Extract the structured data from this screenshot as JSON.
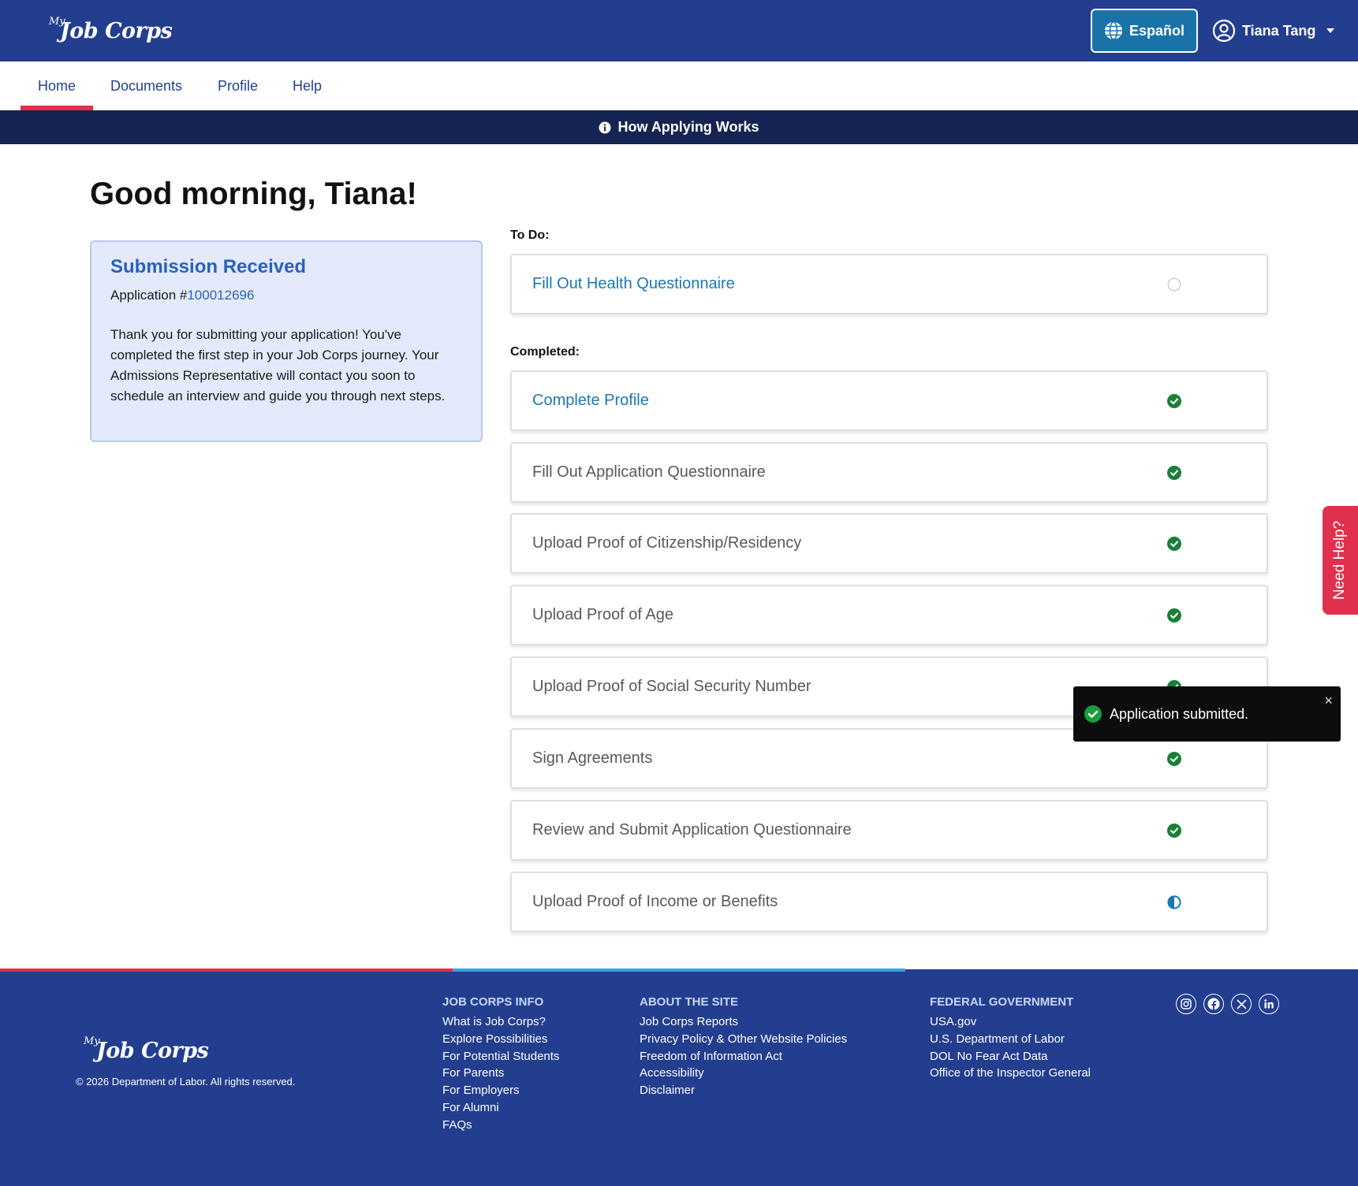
{
  "header": {
    "logo_my": "My",
    "logo_text": "Job Corps",
    "language_button": "Español",
    "user_name": "Tiana Tang"
  },
  "nav": {
    "tabs": [
      {
        "label": "Home",
        "active": true
      },
      {
        "label": "Documents",
        "active": false
      },
      {
        "label": "Profile",
        "active": false
      },
      {
        "label": "Help",
        "active": false
      }
    ]
  },
  "info_bar": {
    "label": "How Applying Works"
  },
  "main": {
    "greeting": "Good morning, Tiana!",
    "submission_card": {
      "title": "Submission Received",
      "application_prefix": "Application #",
      "application_number": "100012696",
      "body": "Thank you for submitting your application! You've completed the first step in your Job Corps journey. Your Admissions Representative will contact you soon to schedule an interview and guide you through next steps."
    },
    "todo_label": "To Do:",
    "todo_items": [
      {
        "label": "Fill Out Health Questionnaire",
        "status": "not-started"
      }
    ],
    "completed_label": "Completed:",
    "completed_items": [
      {
        "label": "Complete Profile",
        "status": "complete"
      },
      {
        "label": "Fill Out Application Questionnaire",
        "status": "complete"
      },
      {
        "label": "Upload Proof of Citizenship/Residency",
        "status": "complete"
      },
      {
        "label": "Upload Proof of Age",
        "status": "complete"
      },
      {
        "label": "Upload Proof of Social Security Number",
        "status": "complete"
      },
      {
        "label": "Sign Agreements",
        "status": "complete"
      },
      {
        "label": "Review and Submit Application Questionnaire",
        "status": "complete"
      },
      {
        "label": "Upload Proof of Income or Benefits",
        "status": "in-progress"
      }
    ]
  },
  "need_help": {
    "label": "Need Help?"
  },
  "toast": {
    "message": "Application submitted.",
    "close": "×"
  },
  "footer": {
    "logo_my": "My",
    "logo_text": "Job Corps",
    "copyright": "© 2026 Department of Labor. All rights reserved.",
    "columns": [
      {
        "heading": "JOB CORPS INFO",
        "links": [
          "What is Job Corps?",
          "Explore Possibilities",
          "For Potential Students",
          "For Parents",
          "For Employers",
          "For Alumni",
          "FAQs"
        ]
      },
      {
        "heading": "ABOUT THE SITE",
        "links": [
          "Job Corps Reports",
          "Privacy Policy & Other Website Policies",
          "Freedom of Information Act",
          "Accessibility",
          "Disclaimer"
        ]
      },
      {
        "heading": "FEDERAL GOVERNMENT",
        "links": [
          "USA.gov",
          "U.S. Department of Labor",
          "DOL No Fear Act Data",
          "Office of the Inspector General"
        ]
      }
    ],
    "socials": [
      "instagram-icon",
      "facebook-icon",
      "x-icon",
      "linkedin-icon"
    ]
  },
  "colors": {
    "brand_blue": "#233e8f",
    "accent_red": "#e0304e",
    "success_green": "#1a7f37",
    "link_blue": "#1b78b4"
  }
}
